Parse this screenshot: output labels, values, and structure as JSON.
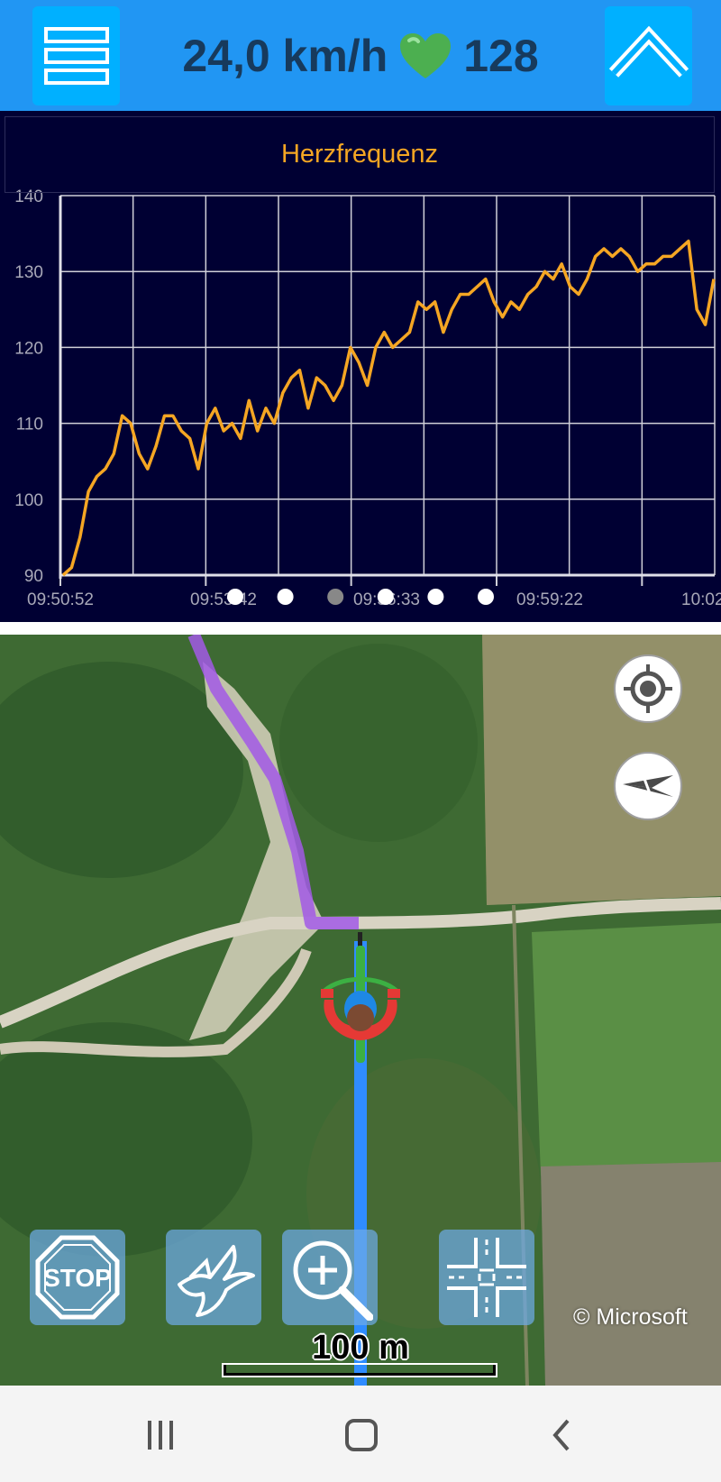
{
  "topbar": {
    "speed": "24,0 km/h",
    "heart_rate": "128",
    "menu_icon": "hamburger-menu-icon",
    "up_icon": "chevron-up-icon"
  },
  "chart_data": {
    "type": "line",
    "title": "Herzfrequenz",
    "ylim": [
      90,
      140
    ],
    "yticks": [
      90,
      100,
      110,
      120,
      130,
      140
    ],
    "xtick_labels": [
      "09:50:52",
      "09:53:42",
      "09:56:33",
      "09:59:22",
      "10:02"
    ],
    "grid": true,
    "color": "#f5a623",
    "series": [
      {
        "values": [
          90,
          91,
          95,
          101,
          103,
          104,
          106,
          111,
          110,
          106,
          104,
          107,
          111,
          111,
          109,
          108,
          104,
          110,
          112,
          109,
          110,
          108,
          113,
          109,
          112,
          110,
          114,
          116,
          117,
          112,
          116,
          115,
          113,
          115,
          120,
          118,
          115,
          120,
          122,
          120,
          121,
          122,
          126,
          125,
          126,
          122,
          125,
          127,
          127,
          128,
          129,
          126,
          124,
          126,
          125,
          127,
          128,
          130,
          129,
          131,
          128,
          127,
          129,
          132,
          133,
          132,
          133,
          132,
          130,
          131,
          131,
          132,
          132,
          133,
          134,
          125,
          123,
          129
        ]
      }
    ]
  },
  "pager": {
    "count": 6,
    "active": 2
  },
  "map": {
    "copyright": "© Microsoft",
    "scale": "100 m",
    "locate_icon": "locate-crosshair-icon",
    "compass_icon": "compass-icon",
    "tools": [
      "stop-sign-icon",
      "bird-icon",
      "zoom-in-icon",
      "intersection-icon"
    ]
  },
  "colors": {
    "topbar": "#2196f3",
    "button": "#00b0ff",
    "chart_bg": "#000033",
    "hr_line": "#f5a623",
    "route_purple": "#a259e6",
    "route_blue": "#2f8cff"
  }
}
